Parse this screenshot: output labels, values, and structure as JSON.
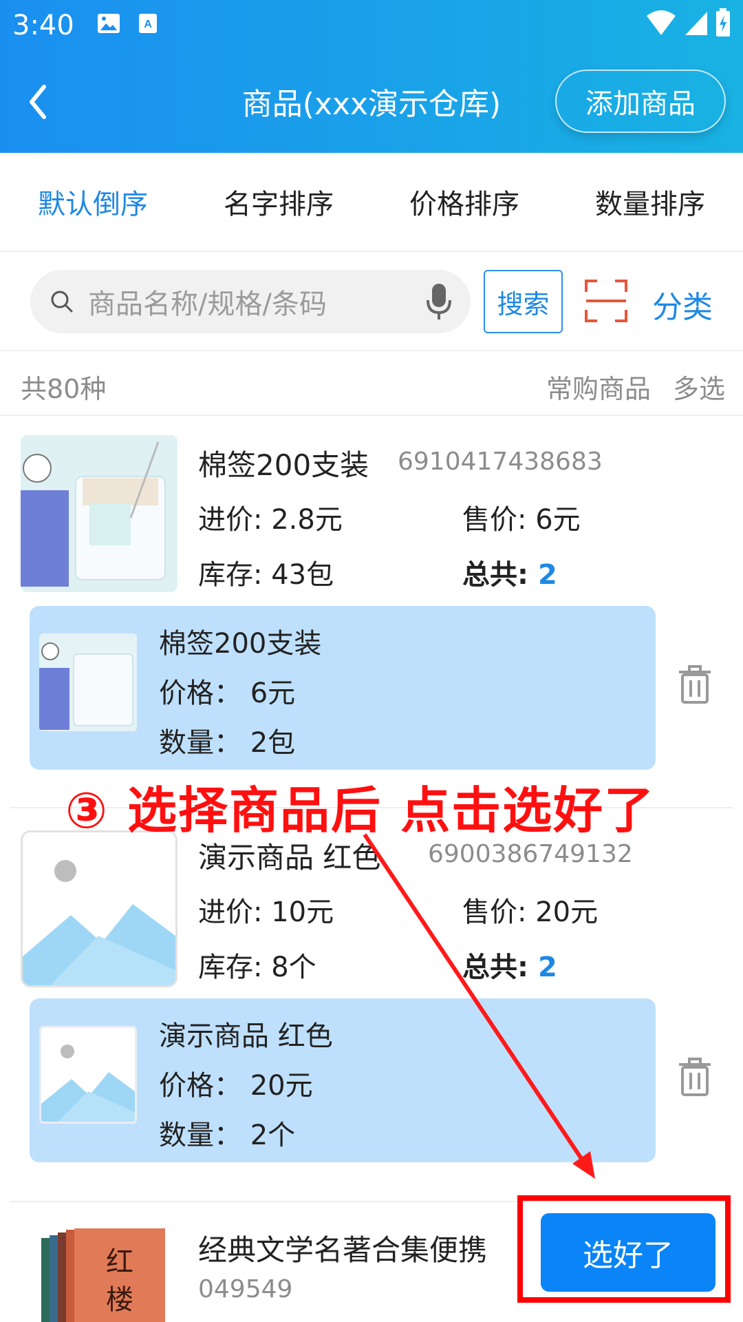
{
  "status_bar": {
    "time": "3:40"
  },
  "header": {
    "title": "商品(xxx演示仓库)",
    "add_button": "添加商品"
  },
  "sort_tabs": [
    {
      "label": "默认倒序",
      "active": true
    },
    {
      "label": "名字排序",
      "active": false
    },
    {
      "label": "价格排序",
      "active": false
    },
    {
      "label": "数量排序",
      "active": false
    }
  ],
  "search": {
    "placeholder": "商品名称/规格/条码",
    "button": "搜索",
    "category": "分类"
  },
  "info": {
    "total": "共80种",
    "frequent": "常购商品",
    "multi_select": "多选"
  },
  "products": [
    {
      "name": "棉签200支装",
      "barcode": "6910417438683",
      "cost_label": "进价:",
      "cost": "2.8元",
      "price_label": "售价:",
      "price": "6元",
      "stock_label": "库存:",
      "stock": "43包",
      "total_label": "总共:",
      "total": "2",
      "cart": {
        "name": "棉签200支装",
        "price_line": "价格：  6元",
        "qty_line": "数量：  2包"
      }
    },
    {
      "name": "演示商品  红色",
      "barcode": "6900386749132",
      "cost_label": "进价:",
      "cost": "10元",
      "price_label": "售价:",
      "price": "20元",
      "stock_label": "库存:",
      "stock": "8个",
      "total_label": "总共:",
      "total": "2",
      "cart": {
        "name": "演示商品 红色",
        "price_line": "价格：  20元",
        "qty_line": "数量：  2个"
      }
    },
    {
      "name": "经典文学名著合集便携",
      "barcode": "049549"
    }
  ],
  "annotation": "③ 选择商品后 点击选好了",
  "confirm_button": "选好了",
  "colors": {
    "accent": "#1e88e5",
    "header_start": "#1a8ff0",
    "header_end": "#19b2e3",
    "cart_bg": "#bfe0fc",
    "annotation": "#ff1010"
  }
}
